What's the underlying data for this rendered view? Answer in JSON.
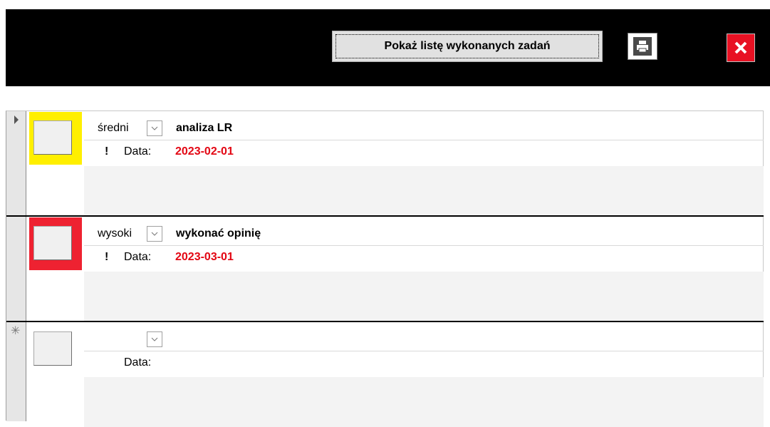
{
  "toolbar": {
    "show_done_label": "Pokaż listę wykonanych zadań",
    "print_icon": "printer-icon",
    "close_icon": "close-icon"
  },
  "records": [
    {
      "priority": "średni",
      "task": "analiza LR",
      "alert": "!",
      "date_label": "Data:",
      "date": "2023-02-01",
      "marker": "current-record",
      "highlight": "#ffef00"
    },
    {
      "priority": "wysoki",
      "task": "wykonać opinię",
      "alert": "!",
      "date_label": "Data:",
      "date": "2023-03-01",
      "marker": "",
      "highlight": "#ee2231"
    },
    {
      "priority": "",
      "task": "",
      "alert": "",
      "date_label": "Data:",
      "date": "",
      "marker": "new-record",
      "highlight": ""
    }
  ],
  "colors": {
    "date": "#e30613",
    "close": "#e81123"
  }
}
